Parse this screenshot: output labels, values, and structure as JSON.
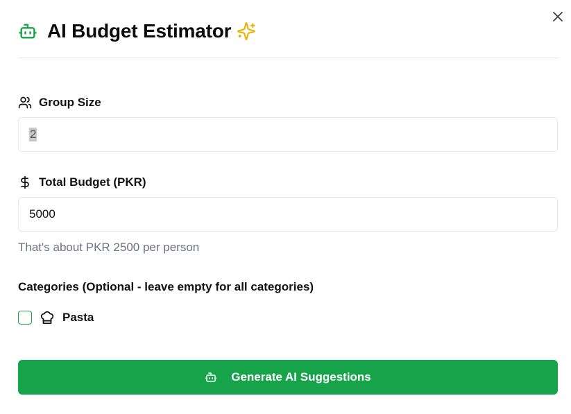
{
  "dialog": {
    "title": "AI Budget Estimator",
    "icons": {
      "title_left": "robot-icon",
      "title_right": "sparkles-icon",
      "close": "close-icon"
    }
  },
  "group_size": {
    "label": "Group Size",
    "icon": "users-icon",
    "value": "2"
  },
  "total_budget": {
    "label": "Total Budget (PKR)",
    "icon": "dollar-icon",
    "value": "5000",
    "hint": "That's about PKR 2500 per person"
  },
  "categories": {
    "label": "Categories (Optional - leave empty for all categories)",
    "items": [
      {
        "label": "Pasta",
        "icon": "chef-hat-icon",
        "checked": false
      }
    ]
  },
  "generate_button": {
    "label": "Generate AI Suggestions",
    "icon": "robot-icon"
  },
  "colors": {
    "accent": "#16a34a",
    "sparkle": "#eab308",
    "muted_text": "#6b7280",
    "border": "#e5e7eb"
  }
}
